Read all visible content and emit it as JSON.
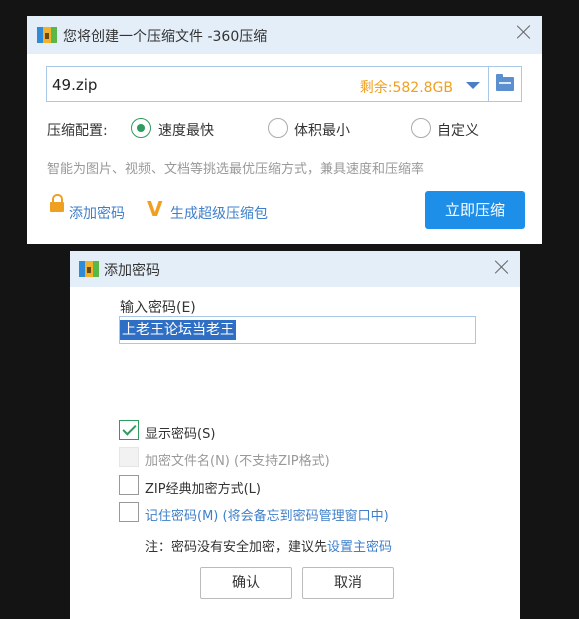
{
  "main_window": {
    "title": "您将创建一个压缩文件 -360压缩",
    "file_name": "49.zip",
    "free_space": "剩余:582.8GB",
    "config_label": "压缩配置:",
    "options": [
      {
        "label": "速度最快",
        "selected": true
      },
      {
        "label": "体积最小",
        "selected": false
      },
      {
        "label": "自定义",
        "selected": false
      }
    ],
    "description": "智能为图片、视频、文档等挑选最优压缩方式，兼具速度和压缩率",
    "add_password_link": "添加密码",
    "super_package_link": "生成超级压缩包",
    "compress_button": "立即压缩"
  },
  "password_dialog": {
    "title": "添加密码",
    "input_label": "输入密码(E)",
    "password_value": "上老王论坛当老王",
    "checkboxes": [
      {
        "label": "显示密码(S)",
        "checked": true,
        "disabled": false
      },
      {
        "label": "加密文件名(N) (不支持ZIP格式)",
        "checked": false,
        "disabled": true
      },
      {
        "label": "ZIP经典加密方式(L)",
        "checked": false,
        "disabled": false
      },
      {
        "label": "记住密码(M) (将会备忘到密码管理窗口中)",
        "checked": false,
        "disabled": false
      }
    ],
    "note_prefix": "注：密码没有安全加密，建议先",
    "note_link": "设置主密码",
    "ok_button": "确认",
    "cancel_button": "取消"
  },
  "colors": {
    "accent_blue": "#1e8fe8",
    "link_blue": "#3f7fc9",
    "orange": "#f0a020",
    "radio_green": "#2f9b5e",
    "titlebar_bg": "#e4eef8"
  }
}
